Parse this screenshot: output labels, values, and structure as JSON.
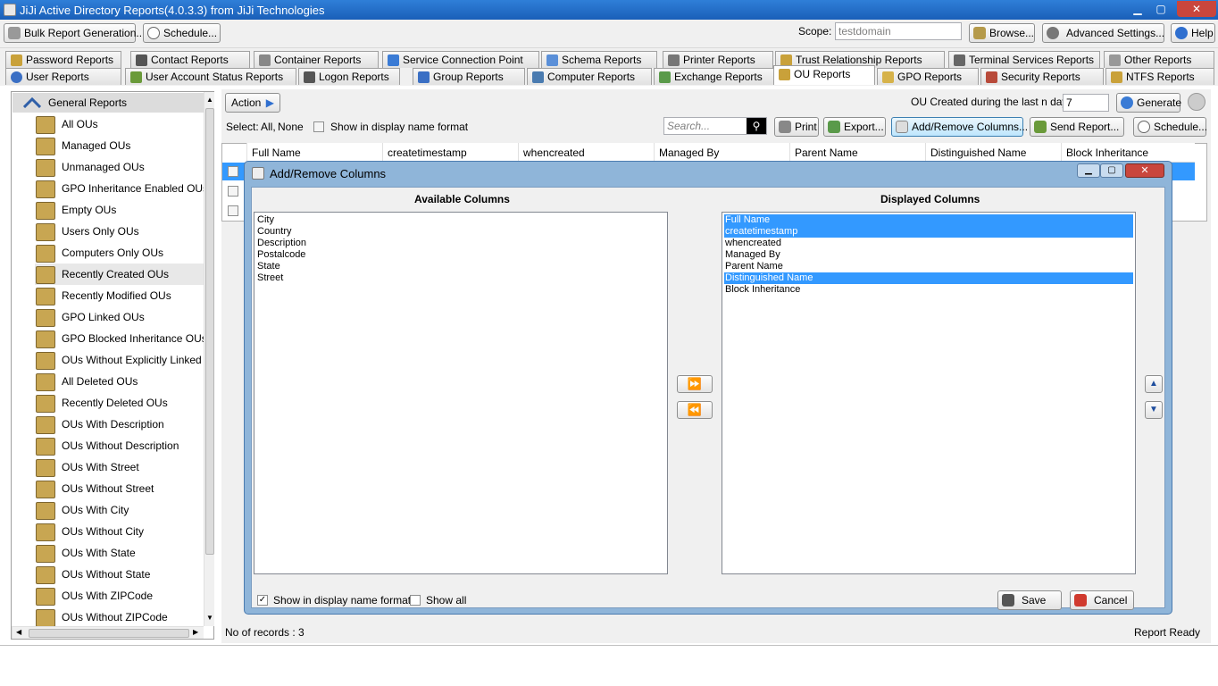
{
  "window": {
    "title": "JiJi Active Directory Reports(4.0.3.3) from JiJi Technologies",
    "min": "▁",
    "max": "▢",
    "close": "✕"
  },
  "toolbar": {
    "bulk": "Bulk Report Generation...",
    "schedule": "Schedule...",
    "scope_label": "Scope:",
    "scope_value": "testdomain",
    "browse": "Browse...",
    "advanced": "Advanced Settings...",
    "help": "Help"
  },
  "tabs_row1": [
    "Password Reports",
    "Contact Reports",
    "Container Reports",
    "Service Connection Point",
    "Schema Reports",
    "Printer Reports",
    "Trust Relationship Reports",
    "Terminal Services Reports",
    "Other Reports"
  ],
  "tabs_row2": [
    "User Reports",
    "User Account Status Reports",
    "Logon Reports",
    "Group Reports",
    "Computer Reports",
    "Exchange Reports",
    "OU Reports",
    "GPO Reports",
    "Security Reports",
    "NTFS Reports"
  ],
  "left": {
    "header": "General Reports",
    "items": [
      "All OUs",
      "Managed OUs",
      "Unmanaged OUs",
      "GPO Inheritance Enabled OUs",
      "Empty OUs",
      "Users Only OUs",
      "Computers Only OUs",
      "Recently Created OUs",
      "Recently Modified OUs",
      "GPO Linked OUs",
      "GPO Blocked Inheritance OUs",
      "OUs Without Explicitly Linked GP",
      "All Deleted OUs",
      "Recently Deleted OUs",
      "OUs With Description",
      "OUs Without Description",
      "OUs With Street",
      "OUs Without Street",
      "OUs With City",
      "OUs Without City",
      "OUs With State",
      "OUs Without State",
      "OUs With ZIPCode",
      "OUs Without ZIPCode"
    ],
    "selected_index": 7
  },
  "main": {
    "action": "Action",
    "ou_label": "OU Created during the last n days:",
    "ou_days": "7",
    "generate": "Generate",
    "select_label": "Select:",
    "select_all": "All,",
    "select_none": "None",
    "display_name_format": "Show in display name format",
    "search_placeholder": "Search...",
    "print": "Print",
    "export": "Export...",
    "add_remove": "Add/Remove Columns...",
    "send_report": "Send Report...",
    "schedule": "Schedule...",
    "columns": [
      "Full Name",
      "createtimestamp",
      "whencreated",
      "Managed By",
      "Parent Name",
      "Distinguished Name",
      "Block Inheritance"
    ]
  },
  "dialog": {
    "title": "Add/Remove Columns",
    "available_header": "Available Columns",
    "displayed_header": "Displayed Columns",
    "available": [
      "City",
      "Country",
      "Description",
      "Postalcode",
      "State",
      "Street"
    ],
    "displayed": [
      "Full Name",
      "createtimestamp",
      "whencreated",
      "Managed By",
      "Parent Name",
      "Distinguished Name",
      "Block Inheritance"
    ],
    "displayed_selected": [
      0,
      1,
      5
    ],
    "add_arrow": "⏩",
    "remove_arrow": "⏪",
    "up_arrow": "▲",
    "down_arrow": "▼",
    "show_display_name": "Show in display name format",
    "show_all": "Show all",
    "save": "Save",
    "cancel": "Cancel"
  },
  "status": {
    "records": "No of records : 3",
    "ready": "Report Ready"
  },
  "colors": {
    "accent": "#3399ff",
    "titlebar": "#1f6cc7"
  }
}
